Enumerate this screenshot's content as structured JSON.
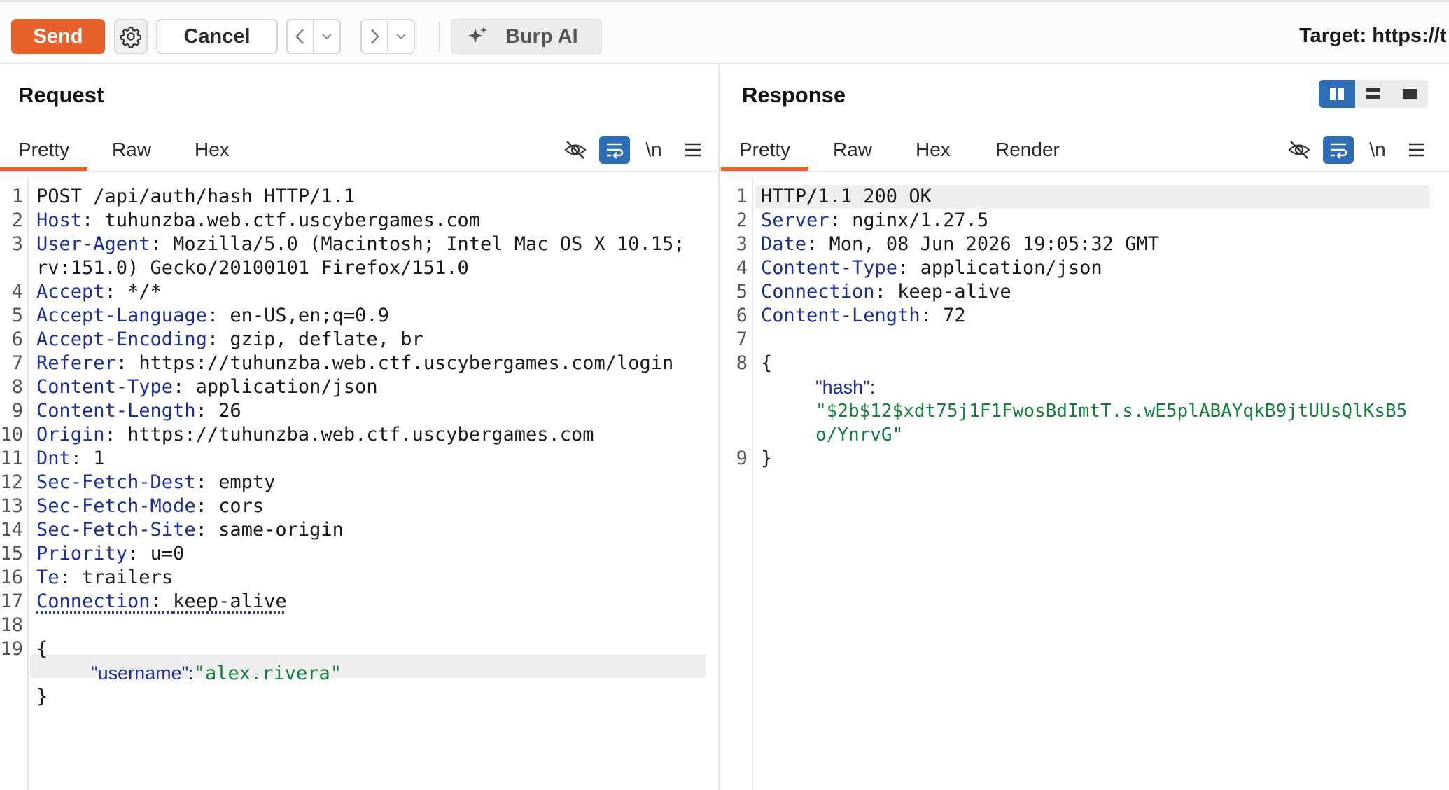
{
  "toolbar": {
    "send_label": "Send",
    "cancel_label": "Cancel",
    "burp_ai_label": "Burp AI",
    "target_text": "Target: https://t",
    "icons": [
      "gear-icon",
      "chevron-left-icon",
      "chevron-down-icon",
      "chevron-right-icon",
      "sparkle-icon"
    ]
  },
  "request": {
    "title": "Request",
    "tabs": [
      "Pretty",
      "Raw",
      "Hex"
    ],
    "active_tab": "Pretty",
    "tools": [
      "hide-icon",
      "wrap-icon",
      "\\n",
      "menu-icon"
    ],
    "line_numbers": [
      "1",
      "2",
      "3",
      "",
      "4",
      "5",
      "6",
      "7",
      "8",
      "9",
      "10",
      "11",
      "12",
      "13",
      "14",
      "15",
      "16",
      "17",
      "18",
      "19",
      "",
      ""
    ],
    "lines": [
      {
        "key": "",
        "sep": "",
        "val": "POST /api/auth/hash HTTP/1.1"
      },
      {
        "key": "Host",
        "sep": ": ",
        "val": "tuhunzba.web.ctf.uscybergames.com"
      },
      {
        "key": "User-Agent",
        "sep": ": ",
        "val": "Mozilla/5.0 (Macintosh; Intel Mac OS X 10.15;"
      },
      {
        "key": "",
        "sep": "",
        "val": "rv:151.0) Gecko/20100101 Firefox/151.0"
      },
      {
        "key": "Accept",
        "sep": ": ",
        "val": "*/*"
      },
      {
        "key": "Accept-Language",
        "sep": ": ",
        "val": "en-US,en;q=0.9"
      },
      {
        "key": "Accept-Encoding",
        "sep": ": ",
        "val": "gzip, deflate, br"
      },
      {
        "key": "Referer",
        "sep": ": ",
        "val": "https://tuhunzba.web.ctf.uscybergames.com/login"
      },
      {
        "key": "Content-Type",
        "sep": ": ",
        "val": "application/json"
      },
      {
        "key": "Content-Length",
        "sep": ": ",
        "val": "26"
      },
      {
        "key": "Origin",
        "sep": ": ",
        "val": "https://tuhunzba.web.ctf.uscybergames.com"
      },
      {
        "key": "Dnt",
        "sep": ": ",
        "val": "1"
      },
      {
        "key": "Sec-Fetch-Dest",
        "sep": ": ",
        "val": "empty"
      },
      {
        "key": "Sec-Fetch-Mode",
        "sep": ": ",
        "val": "cors"
      },
      {
        "key": "Sec-Fetch-Site",
        "sep": ": ",
        "val": "same-origin"
      },
      {
        "key": "Priority",
        "sep": ": ",
        "val": "u=0"
      },
      {
        "key": "Te",
        "sep": ": ",
        "val": "trailers"
      },
      {
        "key": "Connection",
        "sep": ": ",
        "val": "keep-alive"
      },
      {
        "key": "",
        "sep": "",
        "val": ""
      },
      {
        "key": "",
        "sep": "",
        "val": "{"
      },
      {
        "key": "",
        "sep": "",
        "val": ""
      },
      {
        "key": "",
        "sep": "",
        "val": "}"
      }
    ],
    "body_key": "\"username\"",
    "body_colon": ":",
    "body_value": "\"alex.rivera\""
  },
  "response": {
    "title": "Response",
    "tabs": [
      "Pretty",
      "Raw",
      "Hex",
      "Render"
    ],
    "active_tab": "Pretty",
    "tools": [
      "hide-icon",
      "wrap-icon",
      "\\n",
      "menu-icon"
    ],
    "layout_options": [
      "split-vertical-icon",
      "split-horizontal-icon",
      "single-pane-icon"
    ],
    "line_numbers": [
      "1",
      "2",
      "3",
      "4",
      "5",
      "6",
      "7",
      "8",
      "",
      "",
      "",
      "9"
    ],
    "lines": [
      {
        "key": "",
        "sep": "",
        "val": "HTTP/1.1 200 OK"
      },
      {
        "key": "Server",
        "sep": ": ",
        "val": "nginx/1.27.5"
      },
      {
        "key": "Date",
        "sep": ": ",
        "val": "Mon, 08 Jun 2026 19:05:32 GMT"
      },
      {
        "key": "Content-Type",
        "sep": ": ",
        "val": "application/json"
      },
      {
        "key": "Connection",
        "sep": ": ",
        "val": "keep-alive"
      },
      {
        "key": "Content-Length",
        "sep": ": ",
        "val": "72"
      },
      {
        "key": "",
        "sep": "",
        "val": ""
      },
      {
        "key": "",
        "sep": "",
        "val": "{"
      },
      {
        "key": "",
        "sep": "",
        "val": ""
      },
      {
        "key": "",
        "sep": "",
        "val": ""
      },
      {
        "key": "",
        "sep": "",
        "val": ""
      },
      {
        "key": "",
        "sep": "",
        "val": "}"
      }
    ],
    "body_key": "\"hash\"",
    "body_colon": ":",
    "body_value_line1": "\"$2b$12$xdt75j1F1FwosBdImtT.s.wE5plABAYqkB9jtUUsQlKsB5",
    "body_value_line2": "o/YnrvG\""
  }
}
